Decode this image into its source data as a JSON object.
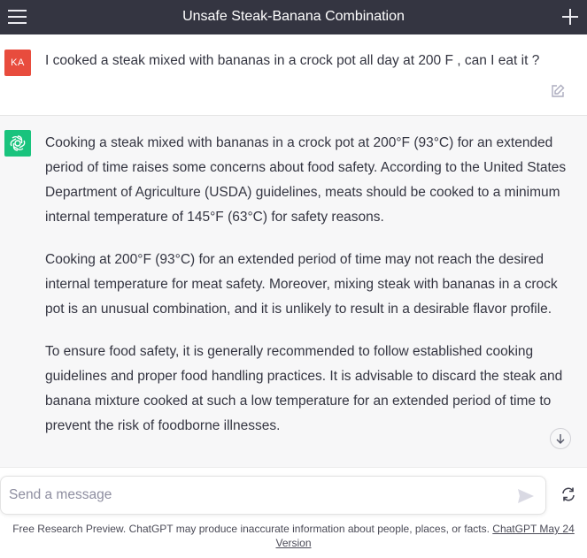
{
  "header": {
    "title": "Unsafe Steak-Banana Combination",
    "menu_icon": "hamburger-menu-icon",
    "new_chat_icon": "plus-icon"
  },
  "user_message": {
    "avatar_initials": "KA",
    "avatar_color": "#e84c3d",
    "text": "I cooked a steak mixed with bananas in a crock pot all day at 200 F , can I eat it ?",
    "edit_icon": "edit-icon"
  },
  "assistant_message": {
    "avatar_color": "#19c37d",
    "avatar_icon": "openai-logo-icon",
    "paragraphs": [
      "Cooking a steak mixed with bananas in a crock pot at 200°F (93°C) for an extended period of time raises some concerns about food safety. According to the United States Department of Agriculture (USDA) guidelines, meats should be cooked to a minimum internal temperature of 145°F (63°C) for safety reasons.",
      "Cooking at 200°F (93°C) for an extended period of time may not reach the desired internal temperature for meat safety. Moreover, mixing steak with bananas in a crock pot is an unusual combination, and it is unlikely to result in a desirable flavor profile.",
      "To ensure food safety, it is generally recommended to follow established cooking guidelines and proper food handling practices. It is advisable to discard the steak and banana mixture cooked at such a low temperature for an extended period of time to prevent the risk of foodborne illnesses."
    ]
  },
  "composer": {
    "placeholder": "Send a message",
    "value": "",
    "send_icon": "send-icon",
    "regenerate_icon": "refresh-icon"
  },
  "footer": {
    "text": "Free Research Preview. ChatGPT may produce inaccurate information about people, places, or facts. ",
    "link_text": "ChatGPT May 24 Version"
  },
  "colors": {
    "header_bg": "#343541",
    "assistant_bg": "#f7f7f8",
    "text": "#343541"
  }
}
